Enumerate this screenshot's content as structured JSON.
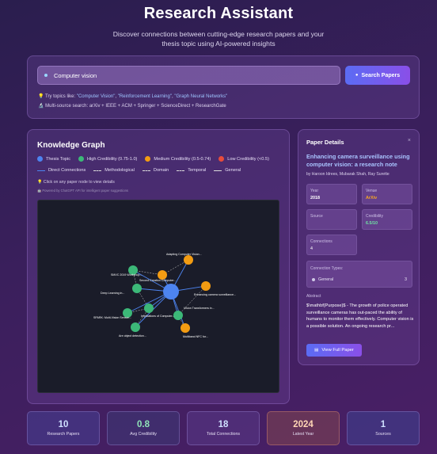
{
  "header": {
    "title": "Research Assistant",
    "subtitle": "Discover connections between cutting-edge research papers and your thesis topic using AI-powered insights"
  },
  "search": {
    "value": "Computer vision",
    "button_label": "Search Papers",
    "hint_prefix": "💡 Try topics like:",
    "topics": [
      "\"Computer Vision\"",
      "\"Reinforcement Learning\"",
      "\"Graph Neural Networks\""
    ],
    "sources_line": "🔬 Multi-source search: arXiv + IEEE + ACM + Springer + ScienceDirect + ResearchGate"
  },
  "graph": {
    "title": "Knowledge Graph",
    "legend_nodes": [
      {
        "label": "Thesis Topic",
        "color": "#4d84f0"
      },
      {
        "label": "High Credibility (0.75-1.0)",
        "color": "#3cb878"
      },
      {
        "label": "Medium Credibility (0.5-0.74)",
        "color": "#f39c12"
      },
      {
        "label": "Low Credibility (<0.5)",
        "color": "#e74c3c"
      }
    ],
    "legend_edges": [
      "Direct Connections",
      "Methodological",
      "Domain",
      "Temporal",
      "General"
    ],
    "edge_colors": {
      "direct": "#4d84f0",
      "other": "#cfcfcf"
    },
    "click_hint": "💡 Click on any paper node to view details",
    "powered_by": "🤖 Powered by ChatGPT API for intelligent paper suggestions",
    "center_node": {
      "label": "",
      "color": "#4d84f0"
    },
    "nodes": [
      {
        "label": "Adapting Computer Vision...",
        "color": "#f39c12"
      },
      {
        "label": "Enhancing camera surveillance...",
        "color": "#f39c12"
      },
      {
        "label": "Vision Transformers in...",
        "color": "#3cb878"
      },
      {
        "label": "Multiband NFC for...",
        "color": "#f39c12"
      },
      {
        "label": "Are object detection...",
        "color": "#3cb878"
      },
      {
        "label": "SPARK: Multi-Vision Sensor...",
        "color": "#3cb878"
      },
      {
        "label": "Deep Learning in...",
        "color": "#3cb878"
      },
      {
        "label": "SMVC 2019 Workshop...",
        "color": "#3cb878"
      },
      {
        "label": "Second Creation Computer...",
        "color": "#f39c12"
      },
      {
        "label": "Implications of Computer...",
        "color": "#3cb878"
      }
    ]
  },
  "details": {
    "title": "Paper Details",
    "close": "×",
    "paper_title": "Enhancing camera surveillance using computer vision: a research note",
    "authors": "by Haroon Idrees, Mubarak Shah, Ray Surette",
    "fields": {
      "year_label": "Year",
      "year_value": "2018",
      "venue_label": "Venue",
      "venue_value": "ArXiv",
      "source_label": "Source",
      "source_value": "",
      "credibility_label": "Credibility",
      "credibility_value": "6.5/10",
      "connections_label": "Connections",
      "connections_value": "4"
    },
    "connection_types_label": "Connection Types:",
    "connection_type": {
      "label": "General",
      "count": "3"
    },
    "abstract_label": "Abstract",
    "abstract": "$\\mathbf{Purpose}$ - The growth of police operated surveillance cameras has out-paced the ability of humans to monitor them effectively. Computer vision is a possible solution. An ongoing research pr...",
    "full_button": "View Full Paper"
  },
  "stats": [
    {
      "value": "10",
      "label": "Research Papers"
    },
    {
      "value": "0.8",
      "label": "Avg Credibility"
    },
    {
      "value": "18",
      "label": "Total Connections"
    },
    {
      "value": "2024",
      "label": "Latest Year"
    },
    {
      "value": "1",
      "label": "Sources"
    }
  ]
}
